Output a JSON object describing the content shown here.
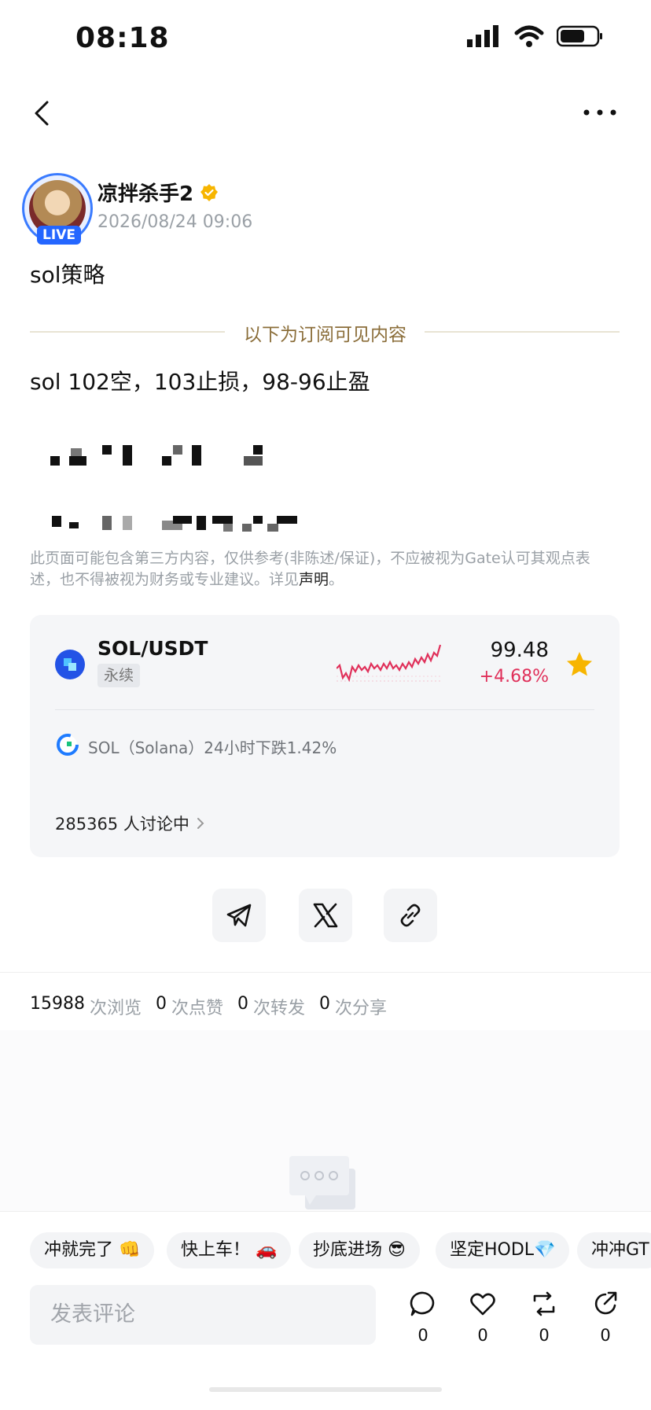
{
  "status_bar": {
    "time": "08:18"
  },
  "author": {
    "name": "凉拌杀手2",
    "live_label": "LIVE",
    "time": "2026/08/24 09:06"
  },
  "post": {
    "title": "sol策略",
    "subscription_divider": "以下为订阅可见内容",
    "line1": "sol 102空，103止损，98-96止盈",
    "disclaimer": "此页面可能包含第三方内容，仅供参考(非陈述/保证)，不应被视为Gate认可其观点表述，也不得被视为财务或专业建议。详见",
    "disclaimer_link": "声明",
    "disclaimer_end": "。"
  },
  "market_card": {
    "pair": "SOL/USDT",
    "tag": "永续",
    "price": "99.48",
    "change": "+4.68%",
    "news": "SOL（Solana）24小时下跌1.42%",
    "discussing": "285365 人讨论中"
  },
  "stats": [
    {
      "num": "15988",
      "label": "次浏览"
    },
    {
      "num": "0",
      "label": "次点赞"
    },
    {
      "num": "0",
      "label": "次转发"
    },
    {
      "num": "0",
      "label": "次分享"
    }
  ],
  "quick_chips": [
    "冲就完了 👊",
    "快上车！ 🚗",
    "抄底进场 😎",
    "坚定HODL💎",
    "冲冲GT"
  ],
  "comment_placeholder": "发表评论",
  "actions": [
    {
      "icon": "comment-icon",
      "count": "0"
    },
    {
      "icon": "heart-icon",
      "count": "0"
    },
    {
      "icon": "repost-icon",
      "count": "0"
    },
    {
      "icon": "share-icon",
      "count": "0"
    }
  ],
  "colors": {
    "accent": "#2466ff",
    "up": "#e0305a",
    "gold": "#f7b500"
  }
}
